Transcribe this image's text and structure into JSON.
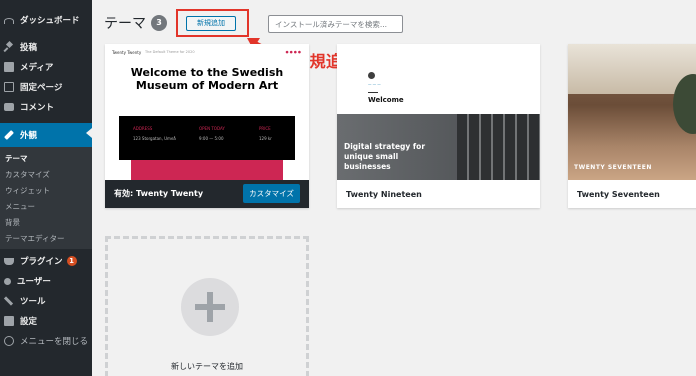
{
  "sidebar": {
    "items": [
      {
        "label": "ダッシュボード"
      },
      {
        "label": "投稿"
      },
      {
        "label": "メディア"
      },
      {
        "label": "固定ページ"
      },
      {
        "label": "コメント"
      },
      {
        "label": "外観"
      },
      {
        "label": "プラグイン",
        "badge": "1"
      },
      {
        "label": "ユーザー"
      },
      {
        "label": "ツール"
      },
      {
        "label": "設定"
      },
      {
        "label": "メニューを閉じる"
      }
    ],
    "submenu": [
      "テーマ",
      "カスタマイズ",
      "ウィジェット",
      "メニュー",
      "背景",
      "テーマエディター"
    ]
  },
  "header": {
    "title": "テーマ",
    "count": "3",
    "add_new_label": "新規追加",
    "search_placeholder": "インストール済みテーマを検索..."
  },
  "annotation": {
    "text": "「新規追加」ボタンをクリック",
    "color": "#e2352a"
  },
  "themes": {
    "active_prefix": "有効:",
    "active_name": "Twenty Twenty",
    "customize_label": "カスタマイズ",
    "tt_preview": {
      "site_name": "Twenty Twenty",
      "tagline": "The Default Theme for 2020",
      "heading": "Welcome to the Swedish Museum of Modern Art",
      "col1": "ADDRESS",
      "col1_val": "123 Storgatan, Umeå",
      "col2": "OPEN TODAY",
      "col2_val": "9:00 — 5:00",
      "col3": "PRICE",
      "col3_val": "129 kr"
    },
    "t19_name": "Twenty Nineteen",
    "t19_preview": {
      "welcome": "Welcome",
      "tagline": "Digital strategy for unique small businesses"
    },
    "t17_name": "Twenty Seventeen",
    "t17_preview": {
      "title": "TWENTY SEVENTEEN"
    },
    "add_new_theme_label": "新しいテーマを追加"
  }
}
